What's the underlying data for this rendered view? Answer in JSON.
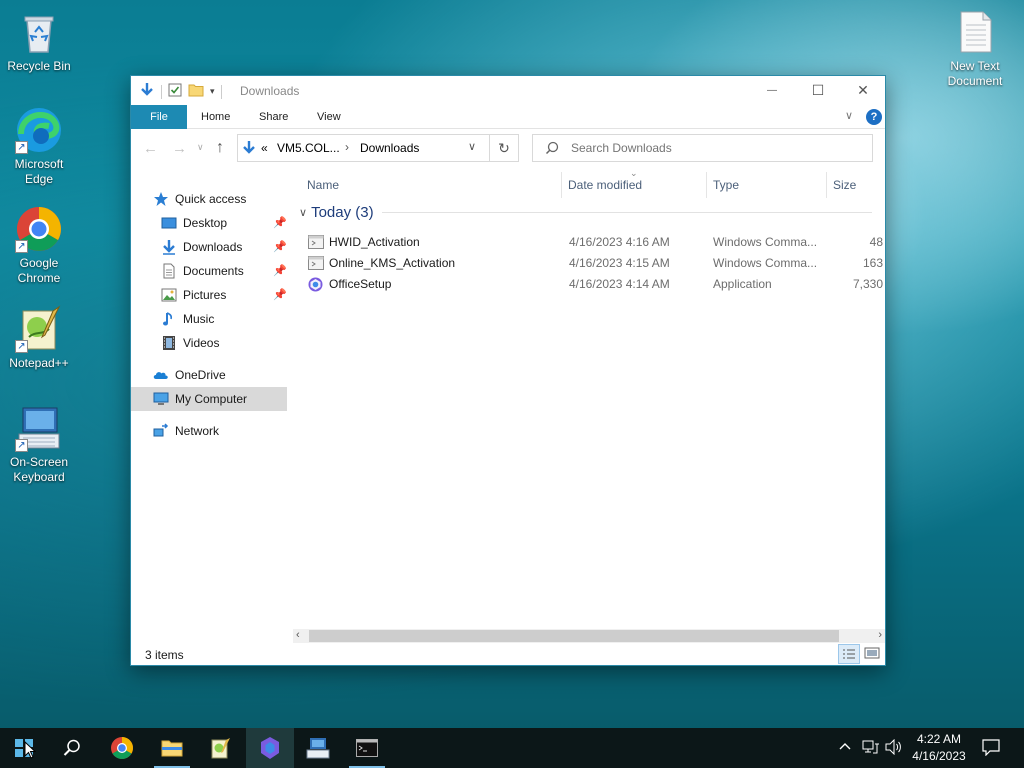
{
  "desktop": {
    "icons": [
      {
        "label": "Recycle Bin"
      },
      {
        "label": "Microsoft Edge"
      },
      {
        "label": "Google Chrome"
      },
      {
        "label": "Notepad++"
      },
      {
        "label": "On-Screen Keyboard"
      },
      {
        "label": "New Text Document"
      }
    ]
  },
  "window": {
    "title": "Downloads",
    "controls": {
      "minimize": "—",
      "maximize": "☐",
      "close": "✕"
    },
    "ribbon_tabs": [
      "File",
      "Home",
      "Share",
      "View"
    ],
    "address": {
      "prefix": "«",
      "segments": [
        "VM5.COL...",
        "Downloads"
      ]
    },
    "search": {
      "placeholder": "Search Downloads"
    },
    "nav": {
      "quick_access": "Quick access",
      "quick_items": [
        {
          "label": "Desktop",
          "pinned": true
        },
        {
          "label": "Downloads",
          "pinned": true
        },
        {
          "label": "Documents",
          "pinned": true
        },
        {
          "label": "Pictures",
          "pinned": true
        },
        {
          "label": "Music",
          "pinned": false
        },
        {
          "label": "Videos",
          "pinned": false
        }
      ],
      "onedrive": "OneDrive",
      "my_computer": "My Computer",
      "network": "Network"
    },
    "columns": {
      "name": "Name",
      "date_modified": "Date modified",
      "type": "Type",
      "size": "Size"
    },
    "group": {
      "label": "Today (3)"
    },
    "files": [
      {
        "name": "HWID_Activation",
        "date": "4/16/2023 4:16 AM",
        "type": "Windows Comma...",
        "size": "48"
      },
      {
        "name": "Online_KMS_Activation",
        "date": "4/16/2023 4:15 AM",
        "type": "Windows Comma...",
        "size": "163"
      },
      {
        "name": "OfficeSetup",
        "date": "4/16/2023 4:14 AM",
        "type": "Application",
        "size": "7,330"
      }
    ],
    "status": {
      "items": "3 items"
    }
  },
  "taskbar": {
    "clock": {
      "time": "4:22 AM",
      "date": "4/16/2023"
    }
  },
  "colors": {
    "ribbon_file": "#1d8ab3",
    "taskbar": "#0c1718",
    "selected_nav": "#d9d9d9"
  }
}
